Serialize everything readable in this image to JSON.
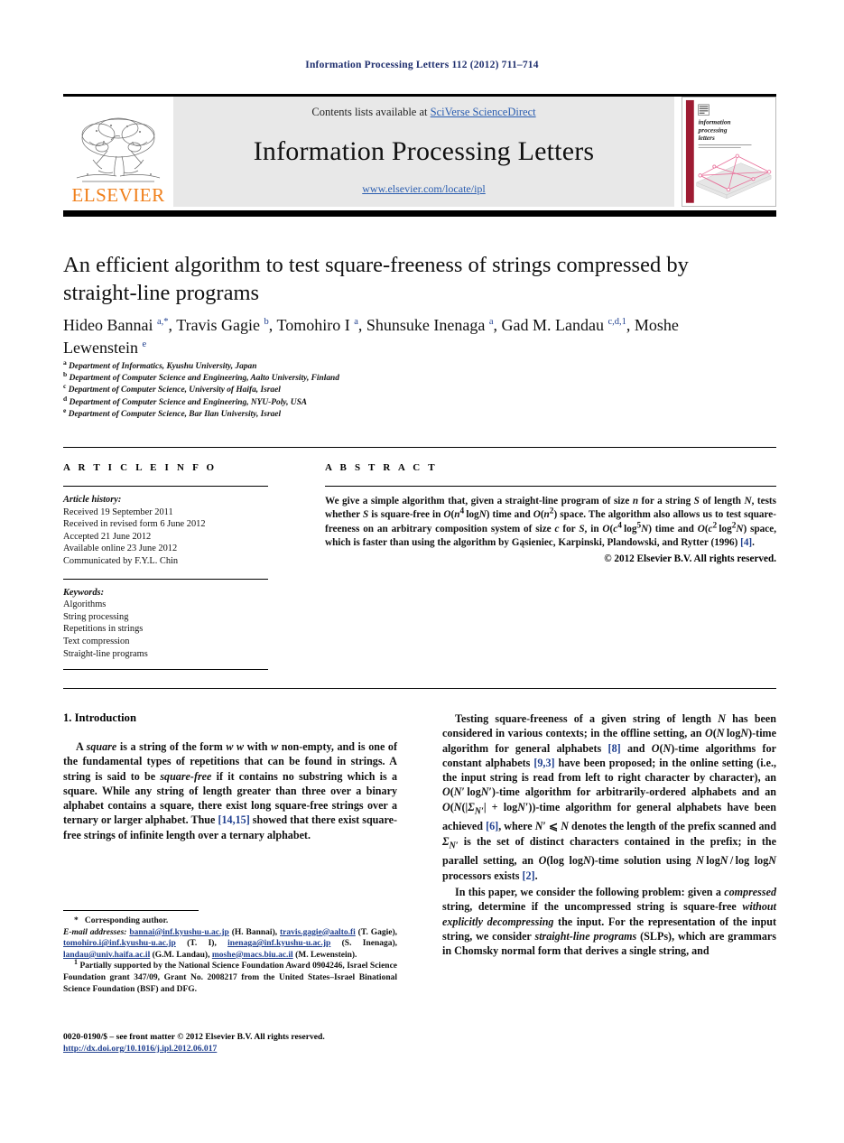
{
  "running_head": "Information Processing Letters 112 (2012) 711–714",
  "masthead": {
    "contents_prefix": "Contents lists available at ",
    "sciencedirect": "SciVerse ScienceDirect",
    "journal_title": "Information Processing Letters",
    "journal_url": "www.elsevier.com/locate/ipl",
    "publisher": "ELSEVIER",
    "cover": {
      "line1": "information",
      "line2": "processing",
      "line3": "letters"
    }
  },
  "article": {
    "title": "An efficient algorithm to test square-freeness of strings compressed by straight-line programs",
    "authors_html": "Hideo Bannai <sup>a,*</sup>, Travis Gagie <sup>b</sup>, Tomohiro I <sup>a</sup>, Shunsuke Inenaga <sup>a</sup>, Gad M. Landau <sup>c,d,1</sup>, Moshe Lewenstein <sup>e</sup>",
    "affiliations": [
      {
        "mark": "a",
        "text": "Department of Informatics, Kyushu University, Japan"
      },
      {
        "mark": "b",
        "text": "Department of Computer Science and Engineering, Aalto University, Finland"
      },
      {
        "mark": "c",
        "text": "Department of Computer Science, University of Haifa, Israel"
      },
      {
        "mark": "d",
        "text": "Department of Computer Science and Engineering, NYU-Poly, USA"
      },
      {
        "mark": "e",
        "text": "Department of Computer Science, Bar Ilan University, Israel"
      }
    ]
  },
  "article_info": {
    "heading": "A R T I C L E    I N F O",
    "history_label": "Article history:",
    "history": [
      "Received 19 September 2011",
      "Received in revised form 6 June 2012",
      "Accepted 21 June 2012",
      "Available online 23 June 2012",
      "Communicated by F.Y.L. Chin"
    ],
    "keywords_label": "Keywords:",
    "keywords": [
      "Algorithms",
      "String processing",
      "Repetitions in strings",
      "Text compression",
      "Straight-line programs"
    ]
  },
  "abstract": {
    "heading": "A B S T R A C T",
    "body_html": "We give a simple algorithm that, given a straight-line program of size <i>n</i> for a string <i>S</i> of length <i>N</i>, tests whether <i>S</i> is square-free in <span class=\"cal\">O</span>(<i>n</i><sup>4</sup>&thinsp;log<i>N</i>) time and <span class=\"cal\">O</span>(<i>n</i><sup>2</sup>) space. The algorithm also allows us to test square-freeness on an arbitrary composition system of size <i>c</i> for <i>S</i>, in <span class=\"cal\">O</span>(<i>c</i><sup>4</sup>&thinsp;log<sup>5</sup><i>N</i>) time and <span class=\"cal\">O</span>(<i>c</i><sup>2</sup>&thinsp;log<sup>2</sup><i>N</i>) space, which is faster than using the algorithm by Gąsieniec, Karpinski, Plandowski, and Rytter (1996) <span class=\"ref\">[4]</span>.",
    "copyright": "© 2012 Elsevier B.V. All rights reserved."
  },
  "body": {
    "section_heading": "1. Introduction",
    "left_paragraph_html": "A <i>square</i> is a string of the form <i>w w</i> with <i>w</i> non-empty, and is one of the fundamental types of repetitions that can be found in strings. A string is said to be <i>square-free</i> if it contains no substring which is a square. While any string of length greater than three over a binary alphabet contains a square, there exist long square-free strings over a ternary or larger alphabet. Thue <span class=\"ref\">[14,15]</span> showed that there exist square-free strings of infinite length over a ternary alphabet.",
    "right_paragraph_1_html": "Testing square-freeness of a given string of length <i>N</i> has been considered in various contexts; in the offline setting, an <span class=\"cal\">O</span>(<i>N</i>&thinsp;log<i>N</i>)-time algorithm for general alphabets <span class=\"ref\">[8]</span> and <span class=\"cal\">O</span>(<i>N</i>)-time algorithms for constant alphabets <span class=\"ref\">[9,3]</span> have been proposed; in the online setting (i.e., the input string is read from left to right character by character), an <span class=\"cal\">O</span>(<i>N</i>&prime;&thinsp;log<i>N</i>&prime;)-time algorithm for arbitrarily-ordered alphabets and an <span class=\"cal\">O</span>(<i>N</i>(|<i>&Sigma;<sub>N&prime;</sub></i>| + log<i>N</i>&prime;))-time algorithm for general alphabets have been achieved <span class=\"ref\">[6]</span>, where <i>N</i>&prime; ⩽ <i>N</i> denotes the length of the prefix scanned and <i>&Sigma;<sub>N&prime;</sub></i> is the set of distinct characters contained in the prefix; in the parallel setting, an <span class=\"cal\">O</span>(log log<i>N</i>)-time solution using <i>N</i>&thinsp;log<i>N</i>&thinsp;/&thinsp;log log<i>N</i> processors exists <span class=\"ref\">[2]</span>.",
    "right_paragraph_2_html": "In this paper, we consider the following problem: given a <i>compressed</i> string, determine if the uncompressed string is square-free <i>without explicitly decompressing</i> the input. For the representation of the input string, we consider <i>straight-line programs</i> (SLPs), which are grammars in Chomsky normal form that derives a single string, and"
  },
  "footnotes": {
    "corresponding": "Corresponding author.",
    "email_label": "E-mail addresses:",
    "emails": [
      {
        "address": "bannai@inf.kyushu-u.ac.jp",
        "name": "(H. Bannai)"
      },
      {
        "address": "travis.gagie@aalto.fi",
        "name": "(T. Gagie)"
      },
      {
        "address": "tomohiro.i@inf.kyushu-u.ac.jp",
        "name": "(T. I)"
      },
      {
        "address": "inenaga@inf.kyushu-u.ac.jp",
        "name": "(S. Inenaga)"
      },
      {
        "address": "landau@univ.haifa.ac.il",
        "name": "(G.M. Landau)"
      },
      {
        "address": "moshe@macs.biu.ac.il",
        "name": "(M. Lewenstein)"
      }
    ],
    "grant_mark": "1",
    "grant_text": "Partially supported by the National Science Foundation Award 0904246, Israel Science Foundation grant 347/09, Grant No. 2008217 from the United States–Israel Binational Science Foundation (BSF) and DFG."
  },
  "footer": {
    "issn_line": "0020-0190/$ – see front matter  © 2012 Elsevier B.V. All rights reserved.",
    "doi": "http://dx.doi.org/10.1016/j.ipl.2012.06.017"
  },
  "colors": {
    "link": "#1f3f8f",
    "elsevier_orange": "#F07F1A",
    "banner_bg": "#e8e8e8",
    "cover_spine": "#9e1b32",
    "cover_art": "#e8709a"
  }
}
